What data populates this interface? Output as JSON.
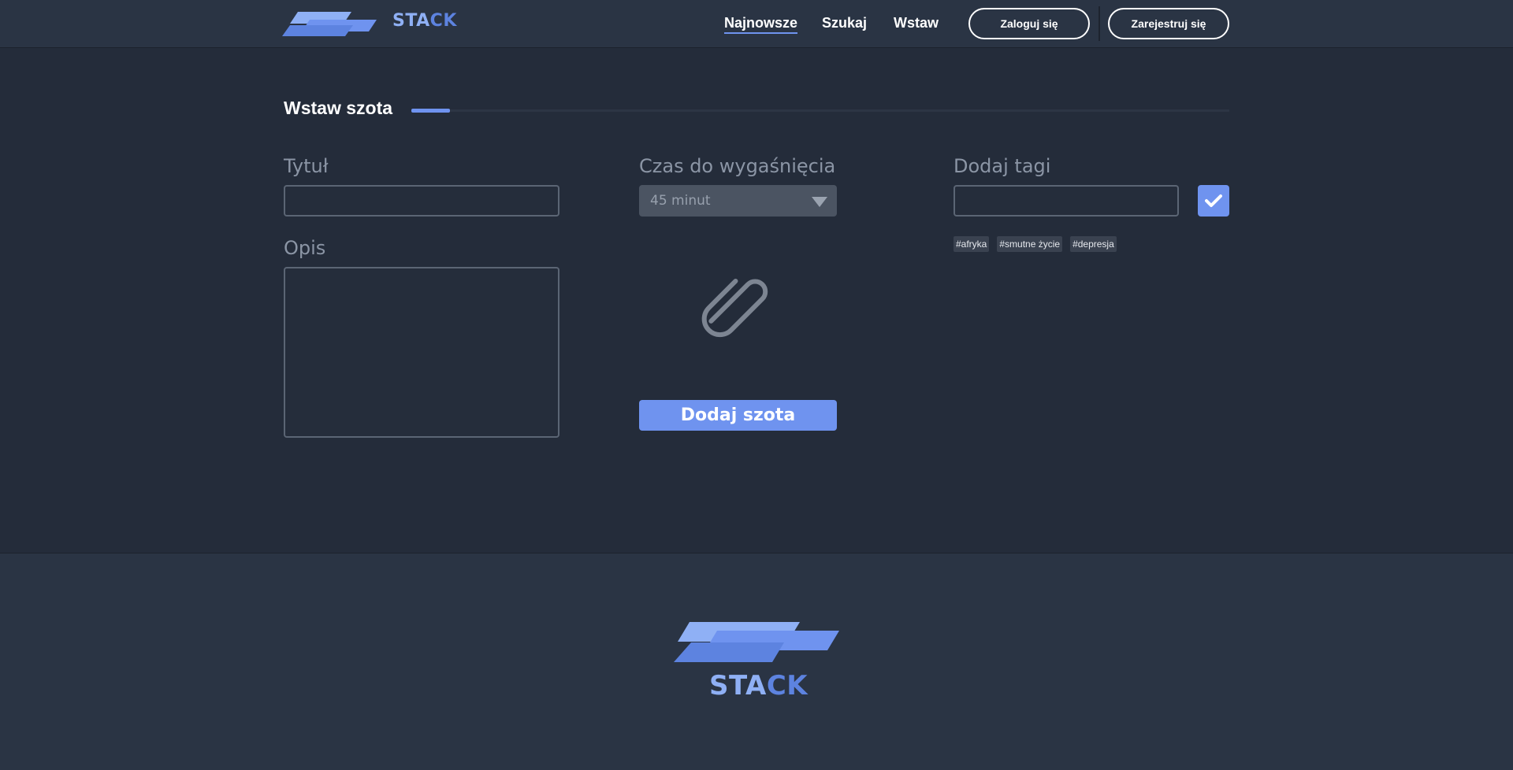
{
  "header": {
    "brand_part1": "STA",
    "brand_part2": "CK",
    "nav": {
      "newest": "Najnowsze",
      "search": "Szukaj",
      "insert": "Wstaw"
    },
    "login_label": "Zaloguj się",
    "register_label": "Zarejestruj się"
  },
  "page": {
    "title": "Wstaw szota"
  },
  "form": {
    "title_label": "Tytuł",
    "title_value": "",
    "description_label": "Opis",
    "description_value": "",
    "expire_label": "Czas do wygaśnięcia",
    "expire_selected": "45 minut",
    "tags_label": "Dodaj tagi",
    "tags_value": "",
    "tags": [
      "#afryka",
      "#smutne życie",
      "#depresja"
    ],
    "submit_label": "Dodaj szota",
    "attach_icon": "paperclip-icon",
    "confirm_icon": "check-icon"
  },
  "footer": {
    "brand_part1": "STA",
    "brand_part2": "CK"
  },
  "colors": {
    "background": "#242c3a",
    "header_bg": "#2a3444",
    "accent": "#6f93ef",
    "logo_light": "#8fb0f5",
    "logo_dark": "#5d83e0"
  }
}
